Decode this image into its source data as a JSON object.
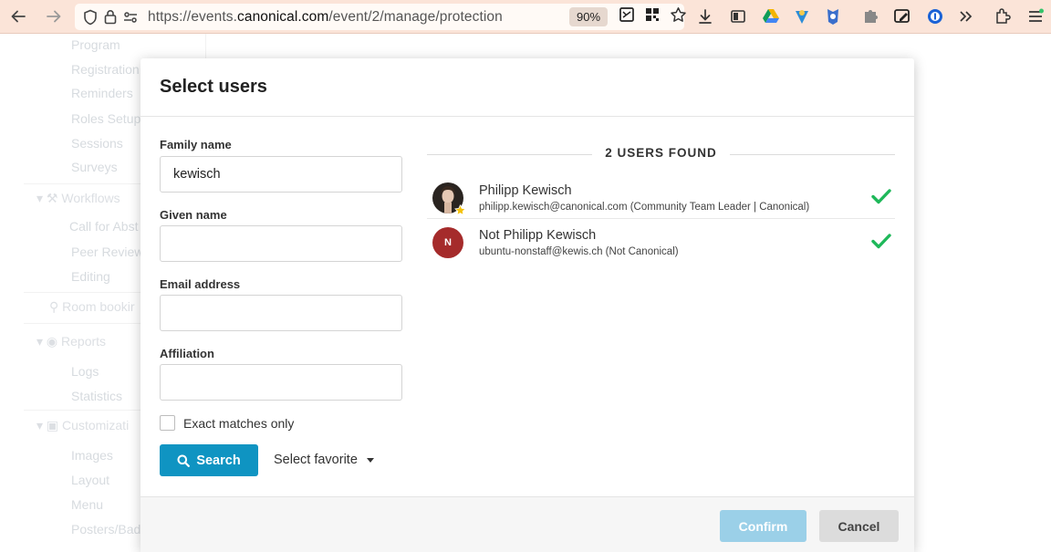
{
  "browser": {
    "url_prefix": "https://events.",
    "url_domain": "canonical.com",
    "url_path": "/event/2/manage/protection",
    "zoom": "90%"
  },
  "sidebar": {
    "items": [
      {
        "label": "Program"
      },
      {
        "label": "Registration"
      },
      {
        "label": "Reminders"
      },
      {
        "label": "Roles Setup"
      },
      {
        "label": "Sessions"
      },
      {
        "label": "Surveys"
      },
      {
        "label": "Workflows"
      },
      {
        "label": "Call for Abst"
      },
      {
        "label": "Peer Reviewi"
      },
      {
        "label": "Editing"
      },
      {
        "label": "Room bookir"
      },
      {
        "label": "Reports"
      },
      {
        "label": "Logs"
      },
      {
        "label": "Statistics"
      },
      {
        "label": "Customizati"
      },
      {
        "label": "Images"
      },
      {
        "label": "Layout"
      },
      {
        "label": "Menu"
      },
      {
        "label": "Posters/Bad"
      }
    ]
  },
  "dialog": {
    "title": "Select users",
    "form": {
      "family_name_label": "Family name",
      "family_name_value": "kewisch",
      "given_name_label": "Given name",
      "given_name_value": "",
      "email_label": "Email address",
      "email_value": "",
      "affiliation_label": "Affiliation",
      "affiliation_value": "",
      "exact_matches_label": "Exact matches only",
      "search_label": "Search",
      "select_favorite_label": "Select favorite"
    },
    "results": {
      "found_label": "2 USERS FOUND",
      "users": [
        {
          "name": "Philipp Kewisch",
          "meta": "philipp.kewisch@canonical.com (Community Team Leader | Canonical)",
          "selected": true
        },
        {
          "name": "Not Philipp Kewisch",
          "avatar_letter": "N",
          "meta": "ubuntu-nonstaff@kewis.ch (Not Canonical)",
          "selected": true
        }
      ]
    },
    "footer": {
      "confirm_label": "Confirm",
      "cancel_label": "Cancel"
    }
  },
  "colors": {
    "primary": "#0f94c2",
    "confirm_disabled": "#9bd0e8",
    "check_green": "#1fb85a",
    "avatar_red": "#a52b2b"
  }
}
